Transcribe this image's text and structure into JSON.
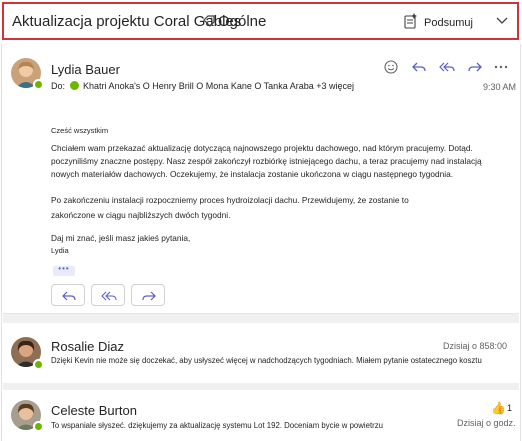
{
  "header": {
    "subject": "Aktualizacja projektu Coral Gables",
    "channel": "Ogólne",
    "summarize_label": "Podsumuj"
  },
  "messages": [
    {
      "sender": "Lydia Bauer",
      "to_prefix": "Do:",
      "recipients": "Khatri Anoka's O Henry Brill O Mona Kane O Tanka Araba +3 więcej",
      "time": "9:30 AM",
      "greeting": "Cześć wszystkim",
      "paragraph1": "Chciałem wam przekazać aktualizację dotyczącą najnowszego projektu dachowego, nad którym pracujemy. Dotąd. poczyniliśmy znaczne postępy. Nasz zespół zakończył rozbiórkę istniejącego dachu, a teraz pracujemy nad instalacją nowych materiałów dachowych. Oczekujemy, że instalacja zostanie ukończona w ciągu następnego tygodnia.",
      "paragraph2a": "Po zakończeniu instalacji rozpoczniemy proces hydroizolacji dachu. Przewidujemy, że zostanie to",
      "paragraph2b": "zakończone w ciągu najbliższych dwóch tygodni.",
      "closing": "Daj mi znać, jeśli masz jakieś pytania,",
      "signature": "Lydia",
      "ellipsis": "•••"
    },
    {
      "sender": "Rosalie Diaz",
      "time": "Dzisiaj o 858:00",
      "preview": "Dzięki Kevin nie może się doczekać, aby usłyszeć więcej w nadchodzących tygodniach. Miałem pytanie ostatecznego kosztu"
    },
    {
      "sender": "Celeste Burton",
      "time": "Dzisiaj o godz.",
      "preview": "To wspaniale słyszeć. dziękujemy za aktualizację systemu Lot 192. Doceniam bycie w powietrzu",
      "reaction": "👍",
      "reaction_count": "1"
    }
  ],
  "colors": {
    "accent": "#5b5fc7",
    "highlight_border": "#d13438",
    "presence": "#6bb700"
  }
}
